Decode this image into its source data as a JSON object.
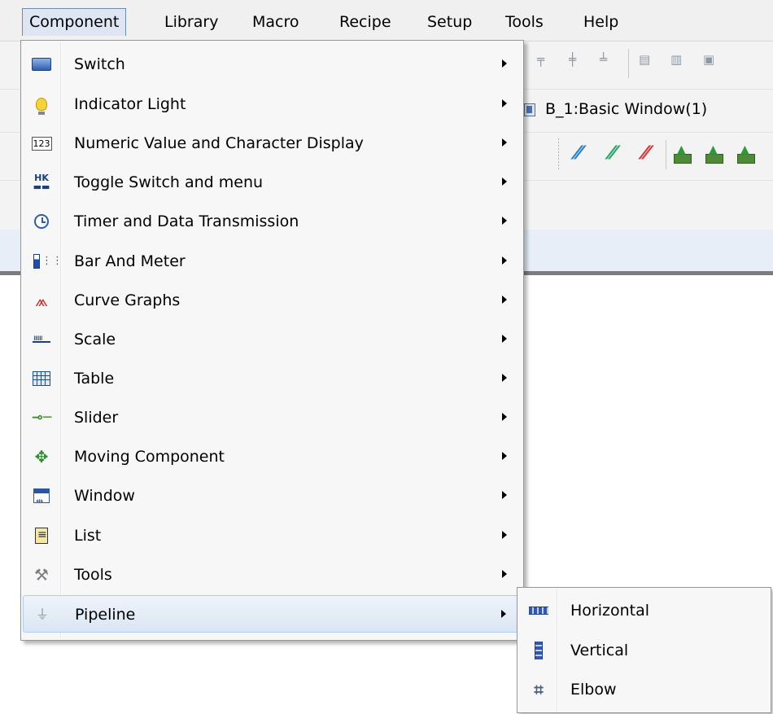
{
  "menubar": {
    "items": [
      "Component",
      "Library",
      "Macro",
      "Recipe",
      "Setup",
      "Tools",
      "Help"
    ],
    "active": "Component"
  },
  "background": {
    "window_tab_title": "B_1:Basic Window(1)"
  },
  "component_menu": {
    "items": [
      {
        "label": "Switch",
        "icon": "switch-icon",
        "has_submenu": true
      },
      {
        "label": "Indicator Light",
        "icon": "light-bulb-icon",
        "has_submenu": true
      },
      {
        "label": "Numeric Value and Character Display",
        "icon": "numeric-123-icon",
        "has_submenu": true
      },
      {
        "label": "Toggle Switch and menu",
        "icon": "toggle-switch-icon",
        "has_submenu": true
      },
      {
        "label": "Timer and Data Transmission",
        "icon": "clock-icon",
        "has_submenu": true
      },
      {
        "label": "Bar And Meter",
        "icon": "bar-meter-icon",
        "has_submenu": true
      },
      {
        "label": "Curve Graphs",
        "icon": "curve-graph-icon",
        "has_submenu": true
      },
      {
        "label": "Scale",
        "icon": "scale-ruler-icon",
        "has_submenu": true
      },
      {
        "label": "Table",
        "icon": "table-grid-icon",
        "has_submenu": true
      },
      {
        "label": "Slider",
        "icon": "slider-icon",
        "has_submenu": true
      },
      {
        "label": "Moving Component",
        "icon": "move-arrows-icon",
        "has_submenu": true
      },
      {
        "label": "Window",
        "icon": "window-icon",
        "has_submenu": true
      },
      {
        "label": "List",
        "icon": "list-icon",
        "has_submenu": true
      },
      {
        "label": "Tools",
        "icon": "tools-icon",
        "has_submenu": true
      },
      {
        "label": "Pipeline",
        "icon": "pipeline-icon",
        "has_submenu": true,
        "highlighted": true
      }
    ]
  },
  "pipeline_submenu": {
    "items": [
      {
        "label": "Horizontal",
        "icon": "horizontal-pipe-icon"
      },
      {
        "label": "Vertical",
        "icon": "vertical-pipe-icon"
      },
      {
        "label": "Elbow",
        "icon": "elbow-pipe-icon"
      }
    ]
  },
  "colors": {
    "menu_background": "#f7f7f7",
    "highlight": "#dbe6f4",
    "highlight_border": "#aecdf1",
    "menubar_active": "#dde6f2"
  }
}
